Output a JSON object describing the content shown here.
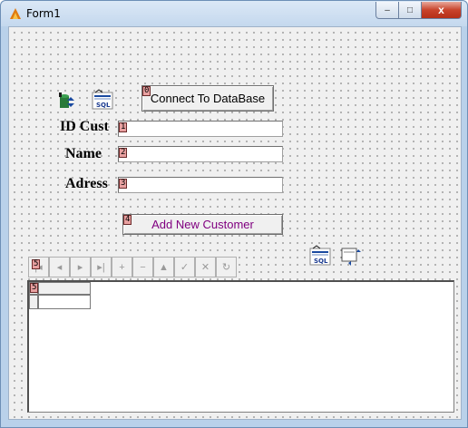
{
  "window": {
    "title": "Form1",
    "controls": {
      "minimize": "–",
      "maximize": "□",
      "close": "x"
    }
  },
  "toolbar_icons": {
    "datasource": "database-component-icon",
    "sql_query": "sql-query-component-icon",
    "sql_label": "SQL"
  },
  "buttons": {
    "connect": "Connect To DataBase",
    "add_customer": "Add New Customer"
  },
  "tab_orders": {
    "connect": "0",
    "id_cust": "1",
    "name": "2",
    "adress": "3",
    "add_customer": "4",
    "grid": "5",
    "navigator": "5"
  },
  "fields": {
    "id_cust": {
      "label": "ID Cust",
      "value": ""
    },
    "name": {
      "label": "Name",
      "value": ""
    },
    "adress": {
      "label": "Adress",
      "value": ""
    }
  },
  "lower_icons": {
    "sql_query2": "sql-query-component-icon",
    "sql_label": "SQL",
    "datasource2": "datasource-component-icon"
  },
  "navigator": {
    "buttons": [
      "first",
      "prior",
      "next",
      "last",
      "insert",
      "delete",
      "edit",
      "post",
      "cancel",
      "refresh"
    ],
    "glyphs": [
      "|◂",
      "◂",
      "▸",
      "▸|",
      "+",
      "−",
      "▲",
      "✓",
      "✕",
      "↻"
    ]
  },
  "colors": {
    "accent_purple": "#800080",
    "tag_fill": "#e8a0a0"
  }
}
